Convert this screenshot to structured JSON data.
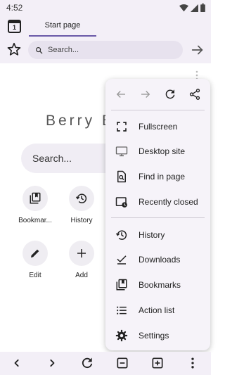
{
  "status_bar": {
    "time": "4:52"
  },
  "tab_bar": {
    "tab_count": "1",
    "start_tab_label": "Start page"
  },
  "address_bar": {
    "placeholder": "Search..."
  },
  "home": {
    "brand_title": "Berry B",
    "search_placeholder": "Search...",
    "shortcuts": [
      {
        "label": "Bookmar...",
        "icon": "bookmarks-icon"
      },
      {
        "label": "History",
        "icon": "history-icon"
      },
      {
        "label": "Edit",
        "icon": "pencil-icon"
      },
      {
        "label": "Add",
        "icon": "plus-icon"
      }
    ]
  },
  "menu": {
    "top_actions": [
      "back-icon",
      "forward-icon",
      "reload-icon",
      "share-icon"
    ],
    "items": [
      {
        "label": "Fullscreen",
        "icon": "fullscreen-icon"
      },
      {
        "label": "Desktop site",
        "icon": "desktop-icon"
      },
      {
        "label": "Find in page",
        "icon": "find-in-page-icon"
      },
      {
        "label": "Recently closed",
        "icon": "recently-closed-icon"
      },
      {
        "label": "History",
        "icon": "history-icon"
      },
      {
        "label": "Downloads",
        "icon": "downloads-icon"
      },
      {
        "label": "Bookmarks",
        "icon": "bookmarks-icon"
      },
      {
        "label": "Action list",
        "icon": "list-icon"
      },
      {
        "label": "Settings",
        "icon": "settings-icon"
      }
    ]
  },
  "bottom_bar": {
    "actions": [
      "back-icon",
      "forward-icon",
      "reload-icon",
      "close-tab-icon",
      "new-tab-icon",
      "more-vert-icon"
    ]
  },
  "colors": {
    "accent": "#6a5aa8",
    "bar_background": "#f3eff7",
    "menu_background": "#f6f3f9"
  }
}
